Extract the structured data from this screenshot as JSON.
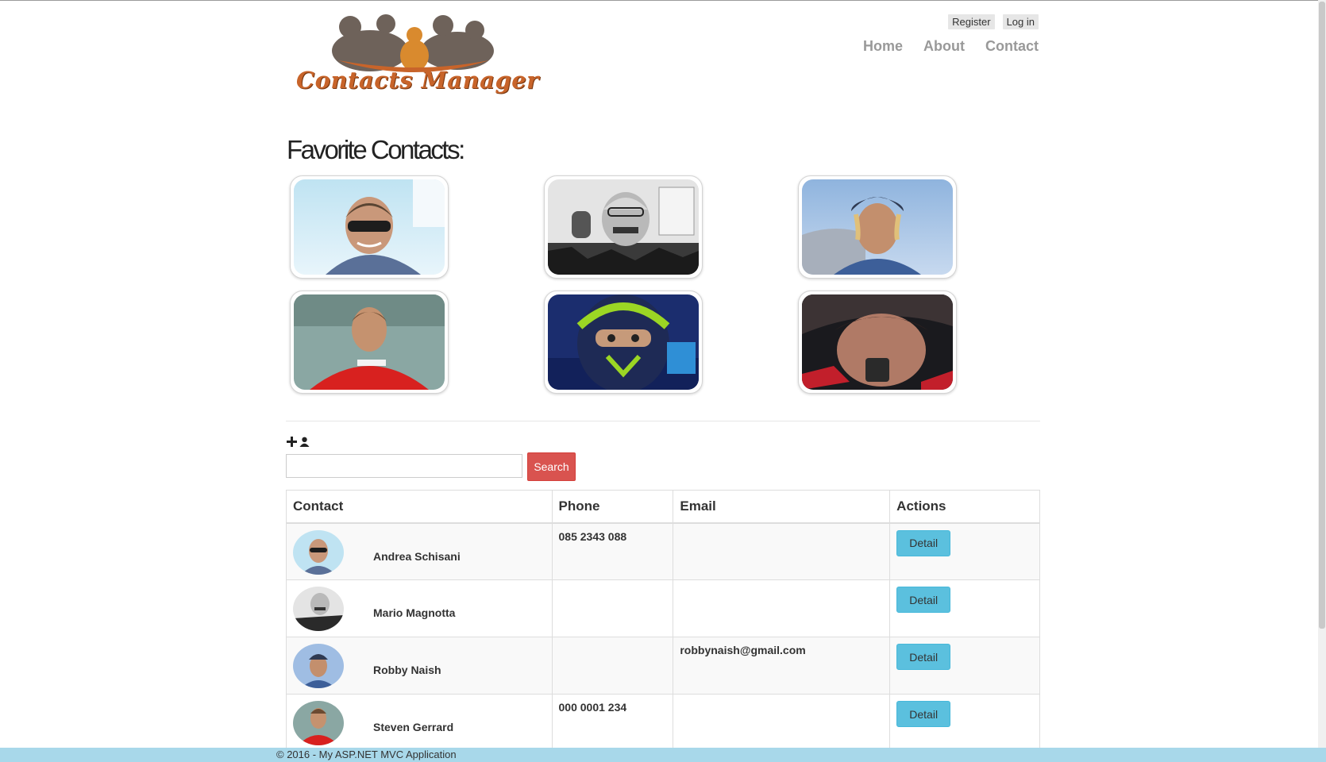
{
  "header": {
    "logo_text": "Contacts Manager",
    "auth": {
      "register": "Register",
      "login": "Log in"
    },
    "nav": [
      {
        "label": "Home"
      },
      {
        "label": "About"
      },
      {
        "label": "Contact"
      }
    ]
  },
  "favorites": {
    "title": "Favorite Contacts:"
  },
  "toolbar": {
    "add_contact_icons": [
      "plus-icon",
      "user-icon"
    ],
    "search_placeholder": "",
    "search_value": "",
    "search_label": "Search"
  },
  "table": {
    "columns": [
      "Contact",
      "Phone",
      "Email",
      "Actions"
    ],
    "rows": [
      {
        "name": "Andrea Schisani",
        "phone": "085 2343 088",
        "email": "",
        "action": "Detail"
      },
      {
        "name": "Mario Magnotta",
        "phone": "",
        "email": "",
        "action": "Detail"
      },
      {
        "name": "Robby Naish",
        "phone": "",
        "email": "robbynaish@gmail.com",
        "action": "Detail"
      },
      {
        "name": "Steven Gerrard",
        "phone": "000 0001 234",
        "email": "",
        "action": "Detail"
      }
    ]
  },
  "footer": {
    "text": "© 2016 - My ASP.NET MVC Application"
  },
  "colors": {
    "logo_orange": "#c8642a",
    "search_button": "#d9534f",
    "detail_button": "#5bc0de",
    "footer_bg": "#a8d8ea"
  }
}
